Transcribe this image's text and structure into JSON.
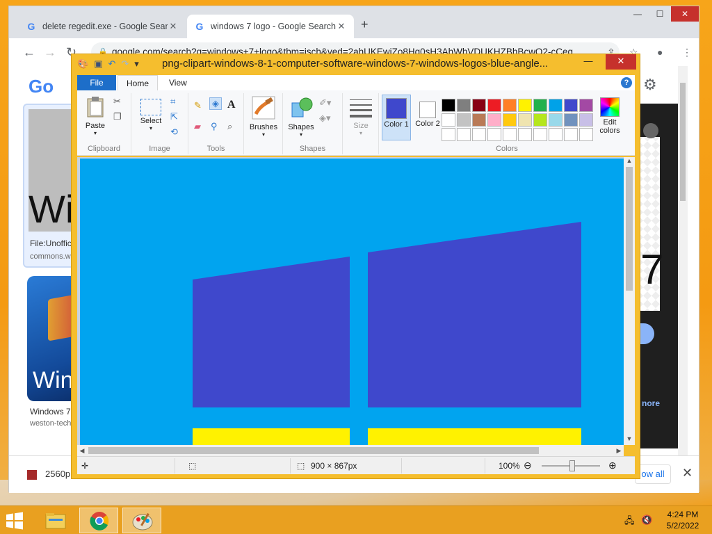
{
  "chrome": {
    "tabs": [
      {
        "label": "delete regedit.exe - Google Search",
        "close": "✕"
      },
      {
        "label": "windows 7 logo - Google Search",
        "close": "✕"
      }
    ],
    "new_tab": "+",
    "window": {
      "minimize": "—",
      "maximize": "☐",
      "close": "✕"
    },
    "url": "google.com/search?q=windows+7+logo&tbm=isch&ved=2ahUKEwiZo8Hq0sH3AhWhVDUKHZBhBcwQ2-cCeg..."
  },
  "google": {
    "logo": "Go",
    "result1": {
      "thumb_text": "Wi",
      "caption": "File:Unoffic",
      "source": "commons.w"
    },
    "result2": {
      "thumb_text": "Win",
      "caption": "Windows 7",
      "source": "weston-tech"
    },
    "right_panel": {
      "big_text": "7",
      "more": "nore"
    }
  },
  "download_bar": {
    "item": "2560p",
    "show_all": "ow all",
    "close": "✕"
  },
  "paint": {
    "title": "png-clipart-windows-8-1-computer-software-windows-7-windows-logos-blue-angle...",
    "tabs": {
      "file": "File",
      "home": "Home",
      "view": "View"
    },
    "ribbon": {
      "clipboard": {
        "paste": "Paste",
        "label": "Clipboard"
      },
      "image": {
        "select": "Select",
        "label": "Image"
      },
      "tools": {
        "label": "Tools"
      },
      "brushes": {
        "label": "Brushes"
      },
      "shapes": {
        "shapes": "Shapes",
        "label": "Shapes"
      },
      "size": {
        "label": "Size"
      },
      "colors": {
        "color1": "Color 1",
        "color2": "Color 2",
        "edit": "Edit colors",
        "label": "Colors",
        "color1_value": "#3f48cc",
        "color2_value": "#ffffff",
        "palette": [
          "#000000",
          "#7f7f7f",
          "#880015",
          "#ed1c24",
          "#ff7f27",
          "#fff200",
          "#22b14c",
          "#00a2e8",
          "#3f48cc",
          "#a349a4",
          "#ffffff",
          "#c3c3c3",
          "#b97a57",
          "#ffaec9",
          "#ffc90e",
          "#efe4b0",
          "#b5e61d",
          "#99d9ea",
          "#7092be",
          "#c8bfe7",
          "#ffffff",
          "#ffffff",
          "#ffffff",
          "#ffffff",
          "#ffffff",
          "#ffffff",
          "#ffffff",
          "#ffffff",
          "#ffffff",
          "#ffffff"
        ]
      }
    },
    "canvas": {
      "background": "#01a4ef",
      "pane_color": "#3f48cc",
      "yellow": "#fff200"
    },
    "status": {
      "dimensions": "900 × 867px",
      "zoom": "100%"
    }
  },
  "taskbar": {
    "time": "4:24 PM",
    "date": "5/2/2022"
  }
}
